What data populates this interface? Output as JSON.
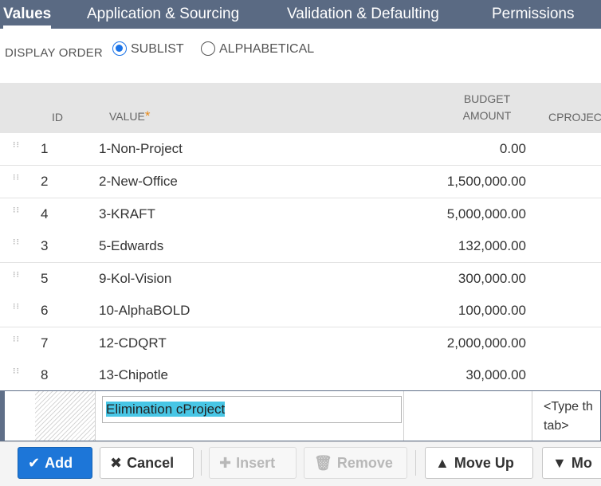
{
  "tabs": [
    {
      "label": "Values",
      "active": true
    },
    {
      "label": "Application & Sourcing",
      "active": false
    },
    {
      "label": "Validation & Defaulting",
      "active": false
    },
    {
      "label": "Permissions",
      "active": false
    }
  ],
  "display_order": {
    "label": "DISPLAY ORDER",
    "options": [
      {
        "label": "SUBLIST",
        "selected": true
      },
      {
        "label": "ALPHABETICAL",
        "selected": false
      }
    ]
  },
  "table": {
    "columns": {
      "id": "ID",
      "value": "VALUE",
      "value_required_mark": "*",
      "budget_line1": "BUDGET",
      "budget_line2": "AMOUNT",
      "cproject": "CPROJEC"
    },
    "rows": [
      {
        "id": "1",
        "value": "1-Non-Project",
        "budget": "0.00"
      },
      {
        "id": "2",
        "value": "2-New-Office",
        "budget": "1,500,000.00"
      },
      {
        "id": "4",
        "value": "3-KRAFT",
        "budget": "5,000,000.00"
      },
      {
        "id": "3",
        "value": "5-Edwards",
        "budget": "132,000.00"
      },
      {
        "id": "5",
        "value": "9-Kol-Vision",
        "budget": "300,000.00"
      },
      {
        "id": "6",
        "value": "10-AlphaBOLD",
        "budget": "100,000.00"
      },
      {
        "id": "7",
        "value": "12-CDQRT",
        "budget": "2,000,000.00"
      },
      {
        "id": "8",
        "value": "13-Chipotle",
        "budget": "30,000.00"
      }
    ]
  },
  "edit_row": {
    "value_input": "Elimination cProject",
    "hint_line1": "<Type th",
    "hint_line2": "tab>"
  },
  "toolbar": {
    "add": "Add",
    "cancel": "Cancel",
    "insert": "Insert",
    "remove": "Remove",
    "move_up": "Move Up",
    "move_down": "Mo"
  },
  "colors": {
    "tab_bar": "#5a6a83",
    "primary_button": "#1d76d8",
    "selection_highlight": "#48c6e5",
    "required_star": "#e88a1a"
  }
}
